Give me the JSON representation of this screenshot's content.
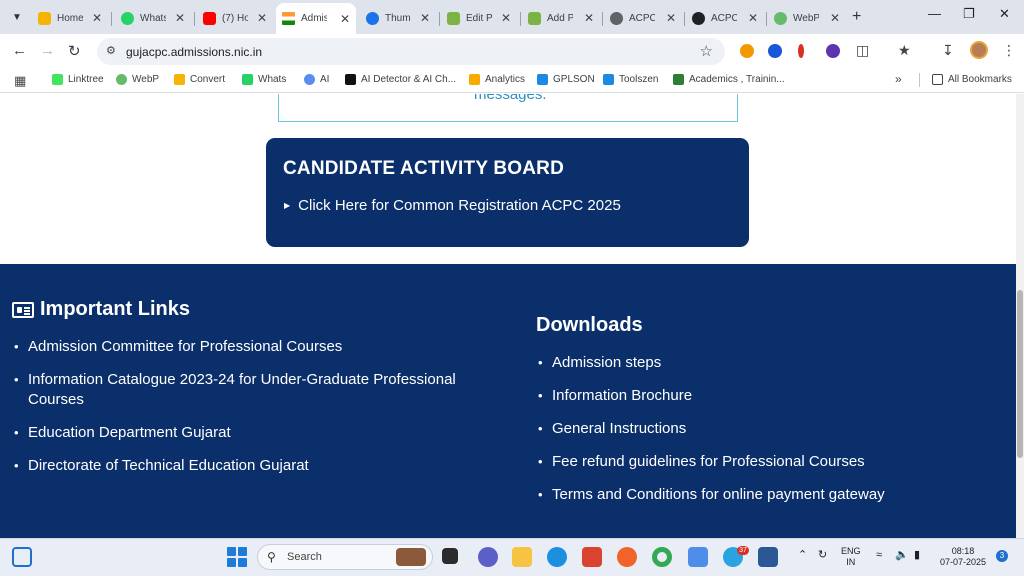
{
  "browser": {
    "tabs": [
      {
        "label": "Home",
        "color": "#f4b400"
      },
      {
        "label": "Whats",
        "color": "#25d366"
      },
      {
        "label": "(7) Ho",
        "color": "#ff0000"
      },
      {
        "label": "Admis",
        "color": "#ff9933"
      },
      {
        "label": "Thum",
        "color": "#1a73e8"
      },
      {
        "label": "Edit P",
        "color": "#7cb342"
      },
      {
        "label": "Add P",
        "color": "#7cb342"
      },
      {
        "label": "ACPC",
        "color": "#5f6368"
      },
      {
        "label": "ACPC",
        "color": "#202124"
      },
      {
        "label": "WebP",
        "color": "#66bb6a"
      }
    ],
    "url": "gujacpc.admissions.nic.in",
    "bookmarks": [
      {
        "label": "Linktree",
        "color": "#43e55e"
      },
      {
        "label": "WebP",
        "color": "#66bb6a"
      },
      {
        "label": "Convert",
        "color": "#f4b400"
      },
      {
        "label": "Whats",
        "color": "#25d366"
      },
      {
        "label": "AI",
        "color": "#5b8def"
      },
      {
        "label": "AI Detector & AI Ch...",
        "color": "#111111"
      },
      {
        "label": "Analytics",
        "color": "#f9ab00"
      },
      {
        "label": "GPLSON",
        "color": "#1e88e5"
      },
      {
        "label": "Toolszen",
        "color": "#1e88e5"
      },
      {
        "label": "Academics , Trainin...",
        "color": "#2e7d32"
      }
    ],
    "all_bookmarks_label": "All Bookmarks"
  },
  "page": {
    "message_tail": "messages.",
    "board": {
      "title": "CANDIDATE ACTIVITY BOARD",
      "link": "Click Here for Common Registration ACPC 2025"
    },
    "important_links": {
      "title": "Important Links",
      "items": [
        "Admission Committee for Professional Courses",
        "Information Catalogue 2023-24 for Under-Graduate Professional Courses",
        "Education Department Gujarat",
        "Directorate of Technical Education Gujarat"
      ]
    },
    "downloads": {
      "title": "Downloads",
      "items": [
        "Admission steps",
        "Information Brochure",
        "General Instructions",
        "Fee refund guidelines for Professional Courses",
        "Terms and Conditions for online payment gateway"
      ]
    }
  },
  "taskbar": {
    "search_placeholder": "Search",
    "telegram_badge": "37",
    "lang": "ENG",
    "region": "IN",
    "time": "08:18",
    "date": "07-07-2025",
    "notifications": "3"
  },
  "colors": {
    "navy": "#0b2f6b",
    "link_blue": "#2b8fbd",
    "tab_strip": "#dfe3eb"
  }
}
